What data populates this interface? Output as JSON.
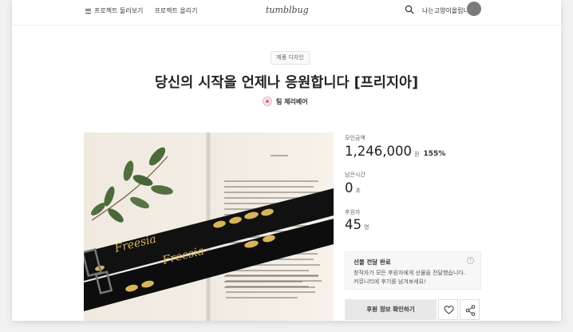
{
  "header": {
    "nav_projects": "프로젝트 둘러보기",
    "nav_start": "프로젝트 올리기",
    "logo": "tumblbug",
    "user_name": "나는고양이올립니다"
  },
  "project": {
    "category": "제품 디자인",
    "title": "당신의 시작을 언제나 응원합니다 [프리지아]",
    "creator": "팀 체리베어",
    "image_text": "Freesia"
  },
  "stats": {
    "raised_label": "모인금액",
    "raised_value": "1,246,000",
    "raised_unit": "원",
    "percent": "155%",
    "remaining_label": "남은시간",
    "remaining_value": "0",
    "remaining_unit": "초",
    "backers_label": "후원자",
    "backers_value": "45",
    "backers_unit": "명"
  },
  "notice": {
    "title": "선물 전달 완료",
    "line1": "창작자가 모든 후원자에게 선물을 전달했습니다.",
    "line2": "커뮤니티에 후기를 남겨보세요!"
  },
  "actions": {
    "support_info": "후원 정보 확인하기",
    "like_icon": "heart-icon",
    "share_icon": "share-icon"
  },
  "colors": {
    "accent": "#222222",
    "button_bg": "#e8e8e8",
    "strap_black": "#111111",
    "embroidery_gold": "#d8b45a"
  }
}
